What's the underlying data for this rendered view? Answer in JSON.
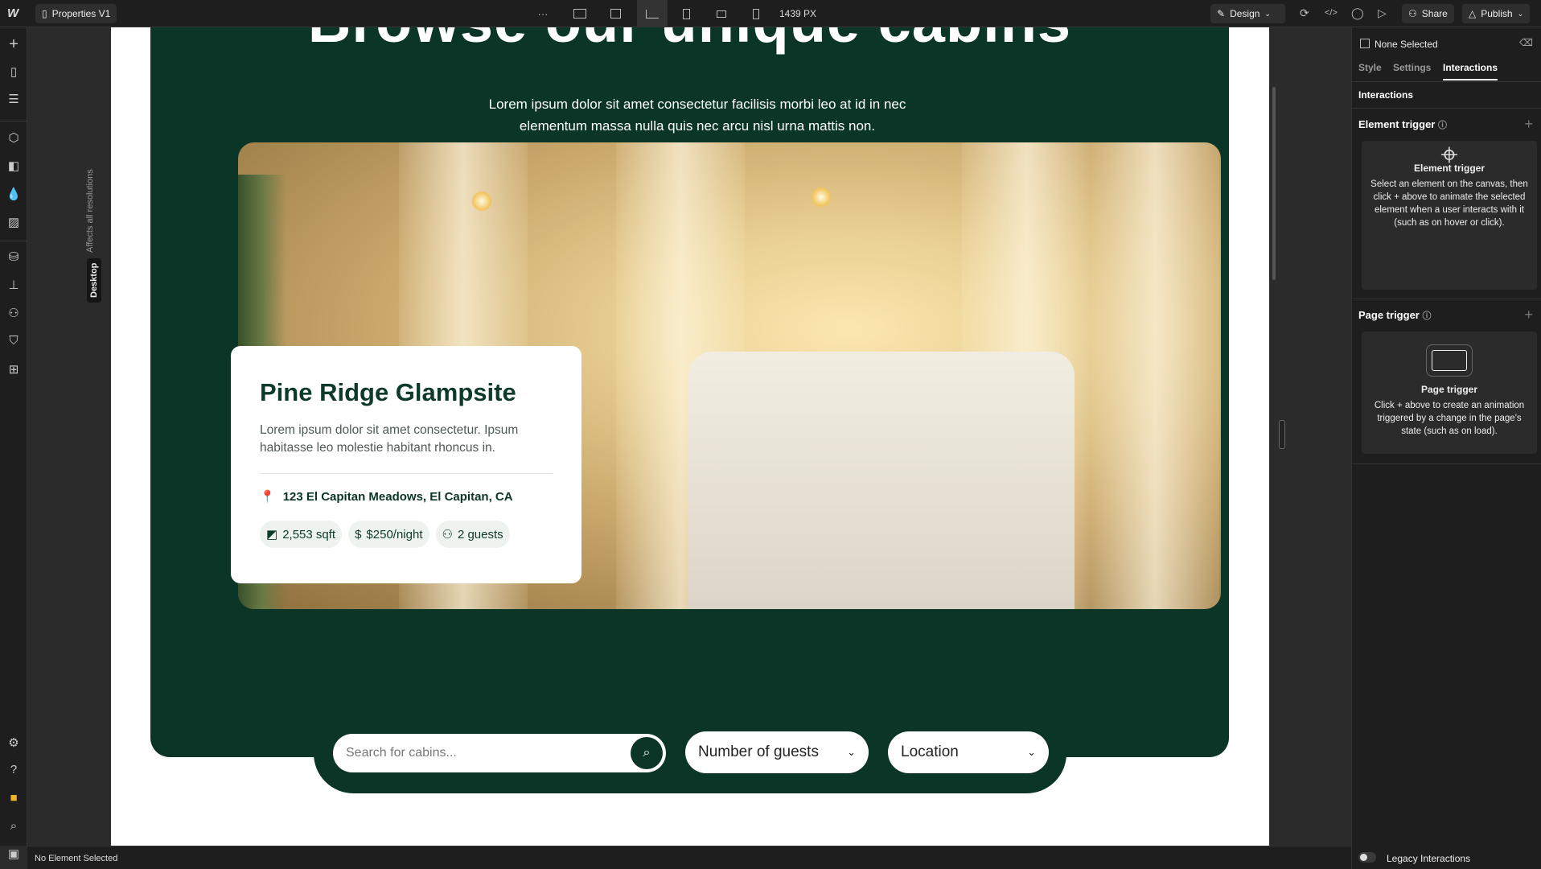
{
  "topbar": {
    "page_name": "Properties V1",
    "more": "···",
    "width_readout": "1439 PX",
    "mode": "Design",
    "share": "Share",
    "publish": "Publish"
  },
  "canvas": {
    "resolution_tag": "Desktop",
    "resolution_note": "Affects all resolutions",
    "hero_title": "Browse our unique cabins",
    "hero_subtitle": "Lorem ipsum dolor sit amet consectetur facilisis morbi leo at id in nec elementum massa nulla quis nec arcu nisl urna mattis non.",
    "card": {
      "title": "Pine Ridge Glampsite",
      "description": "Lorem ipsum dolor sit amet consectetur. Ipsum habitasse leo molestie habitant rhoncus in.",
      "address": "123 El Capitan Meadows, El Capitan, CA",
      "size": "2,553 sqft",
      "price": "$250/night",
      "guests": "2 guests"
    },
    "search": {
      "placeholder": "Search for cabins...",
      "guests_select": "Number of guests",
      "location_select": "Location"
    },
    "colors": {
      "brand_green": "#0b3526"
    }
  },
  "right_panel": {
    "selection": "None Selected",
    "tabs": [
      "Style",
      "Settings",
      "Interactions"
    ],
    "active_tab": "Interactions",
    "section": "Interactions",
    "element_trigger": {
      "heading": "Element trigger",
      "title": "Element trigger",
      "text": "Select an element on the canvas, then click + above to animate the selected element when a user interacts with it (such as on hover or click)."
    },
    "page_trigger": {
      "heading": "Page trigger",
      "title": "Page trigger",
      "text": "Click + above to create an animation triggered by a change in the page's state (such as on load)."
    },
    "legacy_toggle": "Legacy Interactions"
  },
  "statusbar": {
    "text": "No Element Selected"
  }
}
